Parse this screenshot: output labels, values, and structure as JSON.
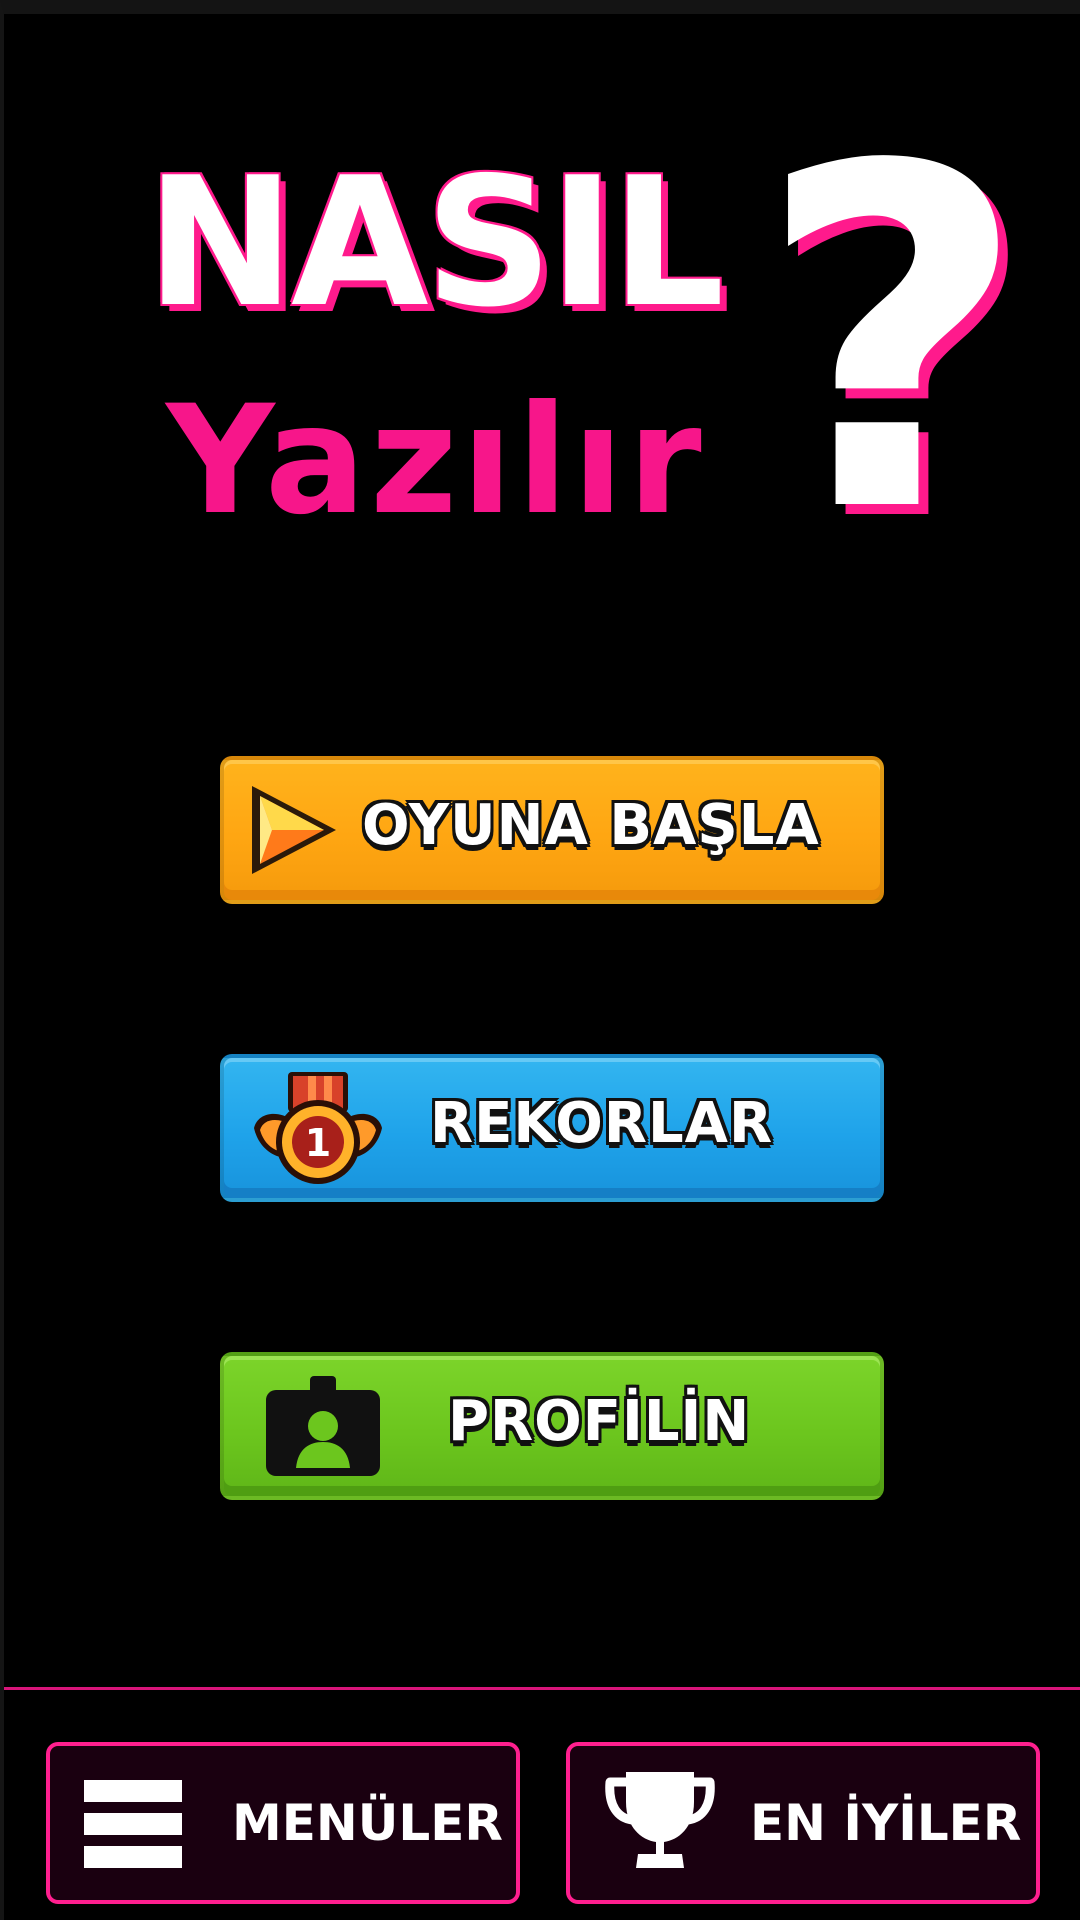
{
  "logo": {
    "line1": "NASIL",
    "line2": "Yazılır",
    "symbol": "?"
  },
  "buttons": {
    "start": {
      "label": "OYUNA BAŞLA",
      "icon": "play-arrow-icon"
    },
    "records": {
      "label": "REKORLAR",
      "icon": "medal-number-one-icon",
      "badge": "1"
    },
    "profile": {
      "label": "PROFİLİN",
      "icon": "id-card-icon"
    }
  },
  "bottom_bar": {
    "menus": {
      "label": "MENÜLER",
      "icon": "hamburger-menu-icon"
    },
    "leaderboard": {
      "label": "EN İYİLER",
      "icon": "trophy-icon"
    }
  },
  "colors": {
    "background": "#000000",
    "accent_pink": "#ff1f8f",
    "start_orange": "#ffa612",
    "records_blue": "#1fa3ea",
    "profile_green": "#6cc61e"
  }
}
